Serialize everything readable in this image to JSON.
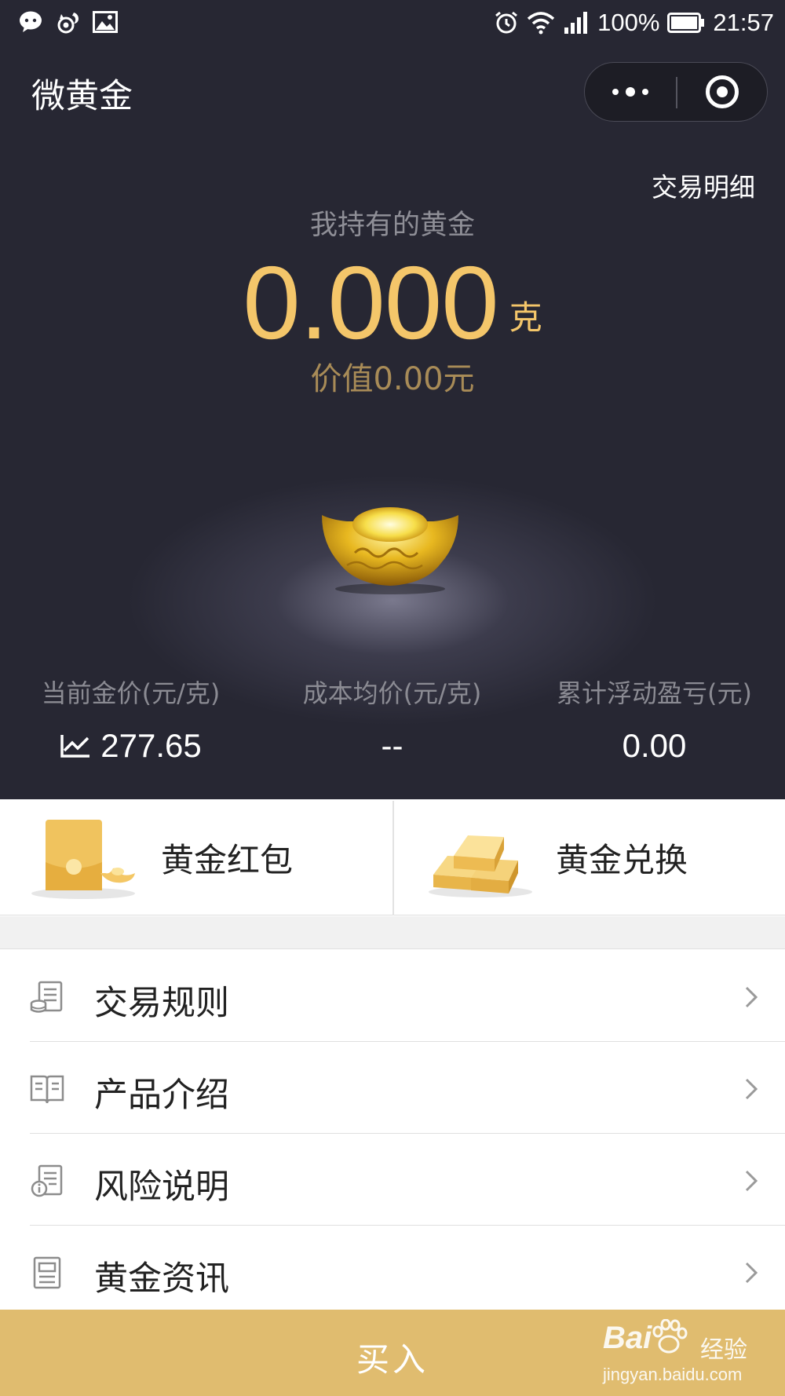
{
  "status_bar": {
    "battery": "100%",
    "time": "21:57",
    "icons": [
      "wechat-icon",
      "squirrel-icon",
      "image-icon",
      "alarm-icon",
      "wifi-icon",
      "signal-icon",
      "battery-icon"
    ]
  },
  "nav": {
    "title": "微黄金",
    "more_icon": "more-dots-icon",
    "close_icon": "close-circle-icon"
  },
  "header": {
    "trade_detail": "交易明细",
    "holding_title": "我持有的黄金",
    "holding_amount": "0.000",
    "holding_unit": "克",
    "holding_value": "价值0.00元"
  },
  "stats": [
    {
      "label": "当前金价(元/克)",
      "value": "277.65",
      "icon": "trend-chart-icon"
    },
    {
      "label": "成本均价(元/克)",
      "value": "--"
    },
    {
      "label": "累计浮动盈亏(元)",
      "value": "0.00"
    }
  ],
  "gold_actions": [
    {
      "label": "黄金红包",
      "icon": "red-envelope-icon"
    },
    {
      "label": "黄金兑换",
      "icon": "gold-bars-icon"
    }
  ],
  "menu": [
    {
      "label": "交易规则",
      "icon": "rules-doc-icon"
    },
    {
      "label": "产品介绍",
      "icon": "open-book-icon"
    },
    {
      "label": "风险说明",
      "icon": "risk-info-icon"
    },
    {
      "label": "黄金资讯",
      "icon": "news-doc-icon"
    }
  ],
  "buy_bar": {
    "label": "买入"
  },
  "watermark": {
    "brand": "Bai",
    "brand_suffix": "经验",
    "domain": "jingyan.baidu.com"
  },
  "colors": {
    "panel_bg": "#272733",
    "gold_text": "#f4c66a",
    "value_text": "#a88b57",
    "buy_bar": "#e0bc6f"
  }
}
